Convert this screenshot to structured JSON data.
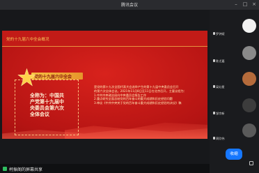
{
  "window": {
    "title": "腾讯会议"
  },
  "slide": {
    "header": "党的十九届六中全会概况",
    "badge": "党的十九届六中全会",
    "left_lines": [
      "全称为：中国共",
      "产党第十九届中",
      "央委员会第六次",
      "全体会议"
    ],
    "right_lines": [
      "是党的第十九次全国代表大会选举产生的第十九届中央委员会召开",
      "的第六次全体会议。2021年11月8日至11日在北京召开，主要议程为：",
      "1.中共中央政治局向中央委员会报告工作",
      "2.重点研究全面总结党的百年奋斗的重大成就和历史经验问题",
      "3.审议《中共中央关于党的百年奋斗重大成就和历史经验的决议》稿"
    ]
  },
  "share": {
    "label": "柯振阁的屏幕共享"
  },
  "participants": [
    {
      "name": "罗钟斌",
      "avatar_color": "#f2f2f2"
    },
    {
      "name": "陈尤嘉",
      "avatar_color": "#8a8a8a"
    },
    {
      "name": "梁幻星",
      "avatar_color": "#b56b3b"
    },
    {
      "name": "邹宗新",
      "avatar_color": "#3c3c3c"
    },
    {
      "name": "周欣伟",
      "avatar_color": "#5a5a5a"
    }
  ],
  "controls": {
    "leave_label": "收缩"
  },
  "colors": {
    "accent": "#1677ff",
    "slide_red": "#c21b17",
    "gold": "#f6c95b"
  }
}
